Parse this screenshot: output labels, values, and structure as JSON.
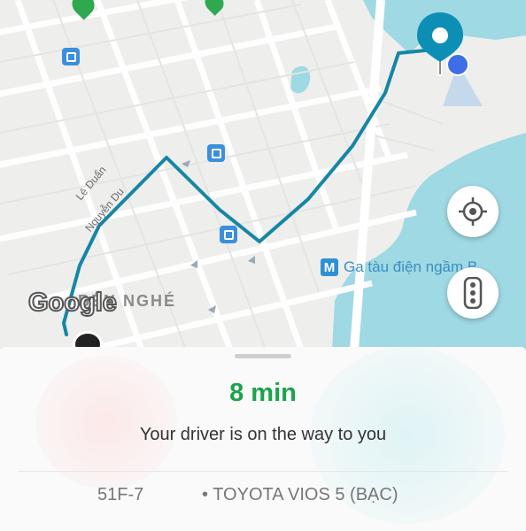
{
  "map": {
    "streets": [
      "Lê Duẩn",
      "Nguyễn Du"
    ],
    "district_label": "BẾN NGHÉ",
    "metro_station": "Ga tàu điện ngầm B",
    "google_logo": "Google",
    "icons": [
      "bus-stop-icon",
      "metro-icon",
      "destination-pin-icon",
      "current-location-icon",
      "traffic-light-icon",
      "place-marker-icon"
    ]
  },
  "trip": {
    "eta": "8 min",
    "status": "Your driver is on the way to you",
    "plate": "51F-7",
    "vehicle": "• TOYOTA VIOS 5 (BẠC)"
  },
  "colors": {
    "route": "#1686a6",
    "eta_green": "#1aa34a",
    "water": "#9fd9e3",
    "pin": "#0d8fb5"
  }
}
